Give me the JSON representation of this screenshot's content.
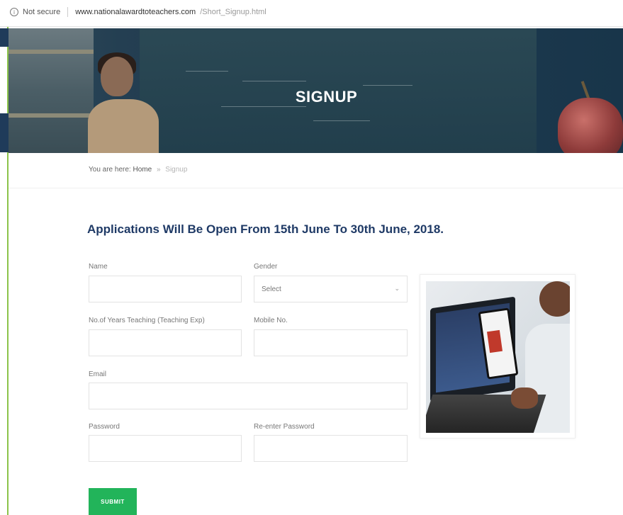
{
  "browser": {
    "security_label": "Not secure",
    "url_host": "www.nationalawardtoteachers.com",
    "url_path": "/Short_Signup.html"
  },
  "hero": {
    "title": "SIGNUP"
  },
  "breadcrumb": {
    "prefix": "You are here:",
    "home": "Home",
    "separator": "»",
    "current": "Signup"
  },
  "main": {
    "heading": "Applications Will Be Open From 15th June To 30th June, 2018."
  },
  "form": {
    "name_label": "Name",
    "gender_label": "Gender",
    "gender_selected": "Select",
    "years_label": "No.of Years Teaching (Teaching Exp)",
    "mobile_label": "Mobile No.",
    "email_label": "Email",
    "password_label": "Password",
    "reenter_password_label": "Re-enter Password",
    "submit_label": "SUBMIT"
  },
  "colors": {
    "heading": "#1f3a66",
    "submit": "#22b45a"
  },
  "icons": {
    "security": "info-icon",
    "select_arrow": "chevron-down-icon"
  }
}
